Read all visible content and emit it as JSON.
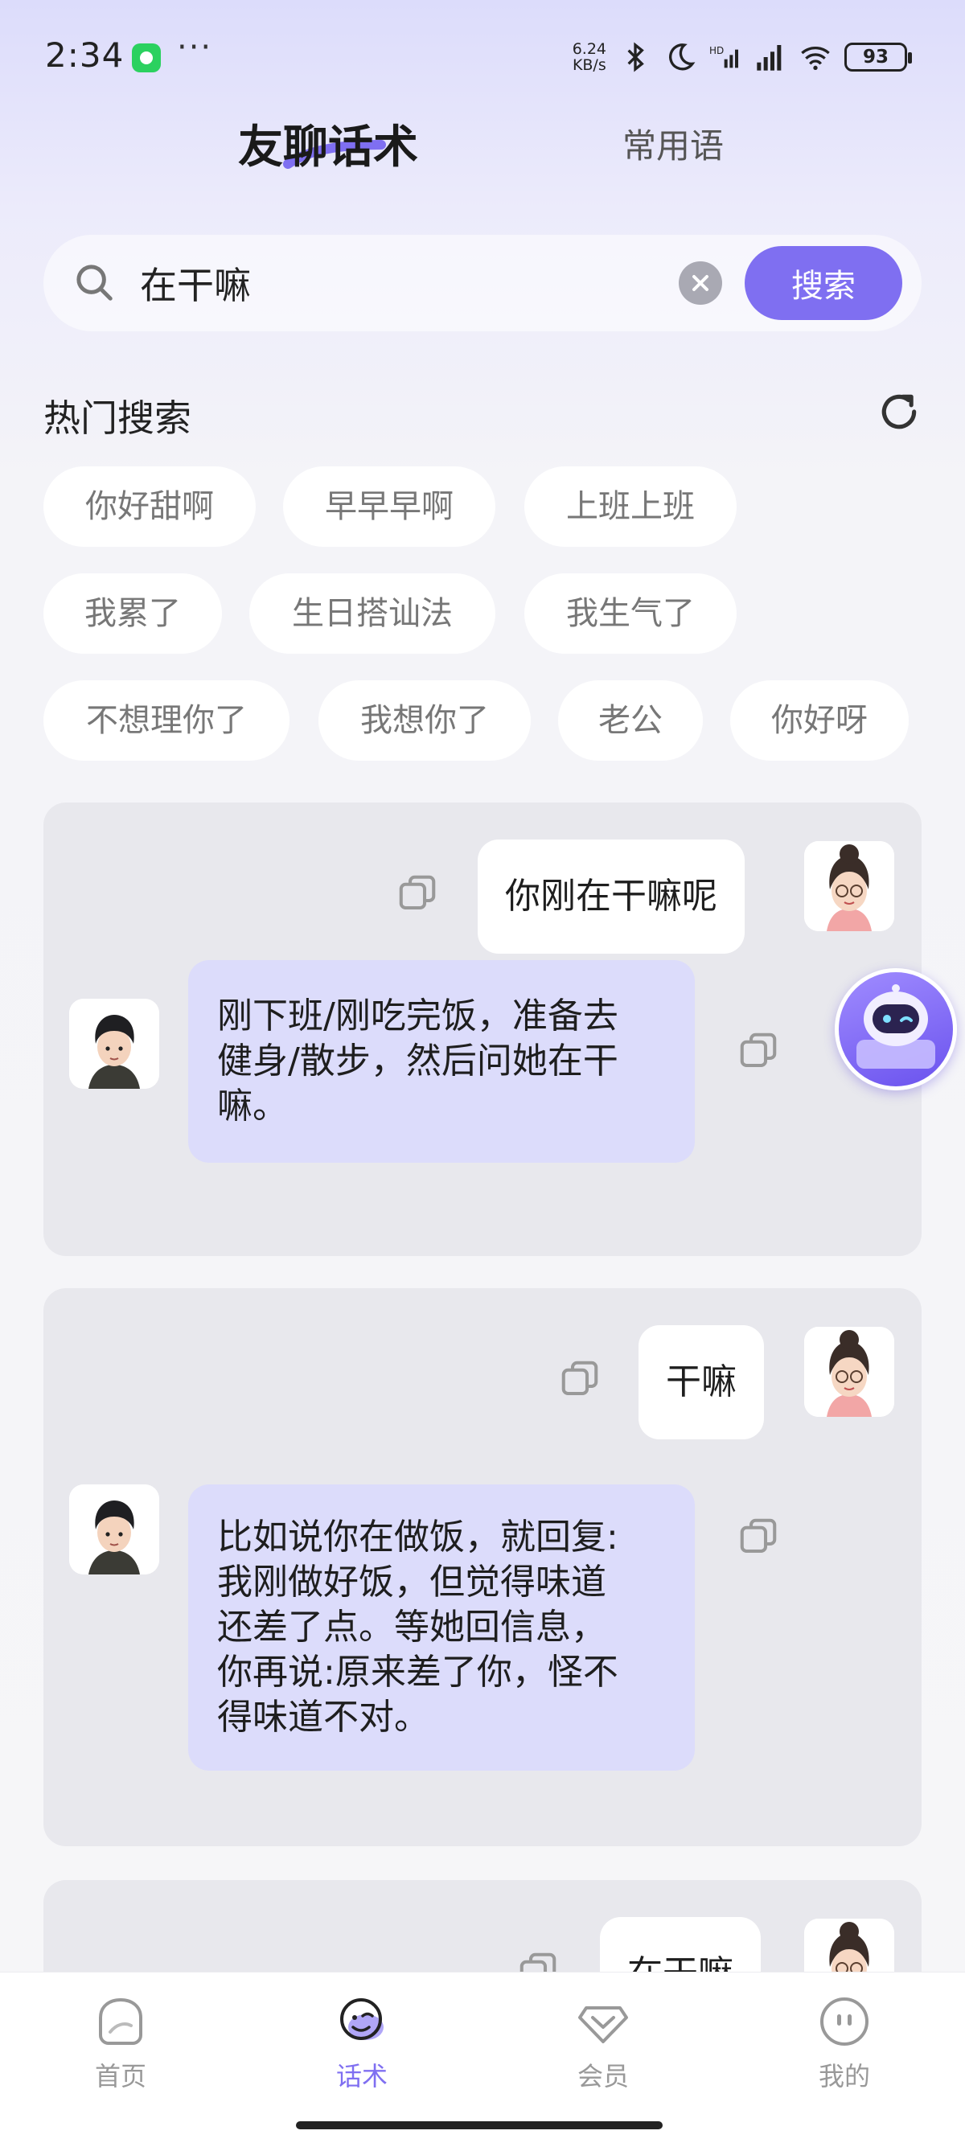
{
  "status_bar": {
    "time": "2:34",
    "more": "···",
    "net_speed_value": "6.24",
    "net_speed_unit": "KB/s",
    "battery": "93"
  },
  "top_tabs": {
    "active": "友聊话术",
    "other": "常用语"
  },
  "search": {
    "value": "在干嘛",
    "placeholder": "",
    "button_label": "搜索"
  },
  "hot_search": {
    "title": "热门搜索",
    "chips": [
      "你好甜啊",
      "早早早啊",
      "上班上班",
      "我累了",
      "生日搭讪法",
      "我生气了",
      "不想理你了",
      "我想你了",
      "老公",
      "你好呀"
    ]
  },
  "conversations": [
    {
      "question": "你刚在干嘛呢",
      "answer_lines": [
        "刚下班/刚吃完饭，准备去",
        "健身/散步，然后问她在干",
        "嘛。"
      ]
    },
    {
      "question": "干嘛",
      "answer_lines": [
        "比如说你在做饭，就回复:",
        "我刚做好饭，但觉得味道",
        "还差了点。等她回信息，",
        "你再说:原来差了你，怪不",
        "得味道不对。"
      ]
    },
    {
      "question": "在干嘛",
      "answer_lines": []
    }
  ],
  "bottom_nav": {
    "items": [
      {
        "label": "首页",
        "icon": "home-icon"
      },
      {
        "label": "话术",
        "icon": "chat-script-icon"
      },
      {
        "label": "会员",
        "icon": "vip-diamond-icon"
      },
      {
        "label": "我的",
        "icon": "profile-icon"
      }
    ],
    "active_index": 1
  },
  "colors": {
    "accent": "#7f6ff1",
    "answer_bubble": "#dcdcfb",
    "card": "#e8e8ed"
  }
}
